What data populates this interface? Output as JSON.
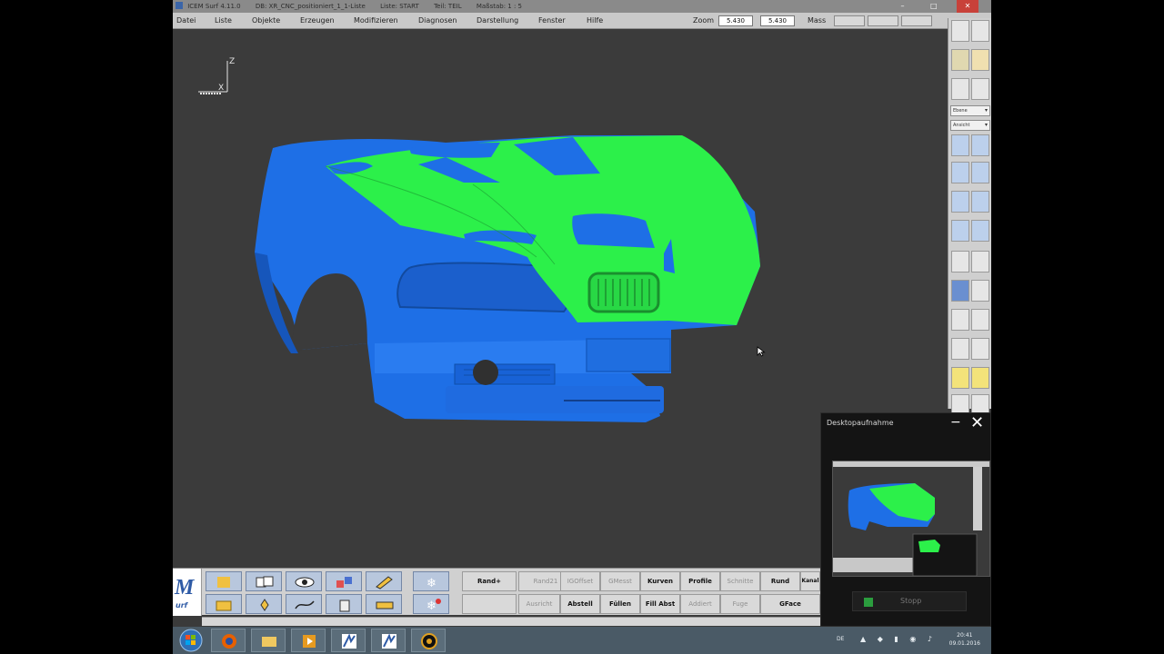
{
  "window": {
    "title_parts": [
      "ICEM Surf 4.11.0",
      "DB: XR_CNC_positioniert_1_1-Liste",
      "Liste: START",
      "Teil: TEIL",
      "Maßstab: 1 : 5"
    ]
  },
  "menu": {
    "items": [
      "Datei",
      "Liste",
      "Objekte",
      "Erzeugen",
      "Modifizieren",
      "Diagnosen",
      "Darstellung",
      "Fenster",
      "Hilfe"
    ],
    "zoom_label": "Zoom",
    "zoom_value_1": "5.430",
    "zoom_value_2": "5.430",
    "mass_label": "Mass"
  },
  "viewport": {
    "axis_z": "Z",
    "axis_x": "X",
    "model_colors": {
      "blue": "#1e6fe6",
      "green": "#2cf04a"
    }
  },
  "right_toolbar": {
    "select_1": "Ebene",
    "select_2": "Ansicht"
  },
  "bottom": {
    "row1": [
      "Rand+",
      "Rand21",
      "IGOffset",
      "GMesst",
      "Kurven",
      "Profile",
      "Schnitte",
      "Rund",
      "Kanal"
    ],
    "row2": [
      "",
      "Ausricht",
      "Abstell",
      "Füllen",
      "Fill Abst",
      "Addiert",
      "Fuge",
      "GFace"
    ],
    "row1_disabled": [
      false,
      true,
      true,
      true,
      false,
      false,
      true,
      false,
      false
    ],
    "row2_disabled": [
      true,
      true,
      false,
      false,
      false,
      true,
      true,
      false
    ]
  },
  "logo": {
    "letter": "M",
    "text": "urf"
  },
  "taskbar": {
    "time": "20:41",
    "date": "09.01.2016",
    "tray_label": "DE"
  },
  "recorder": {
    "title": "Desktopaufnahme",
    "stop_label": "Stopp"
  }
}
